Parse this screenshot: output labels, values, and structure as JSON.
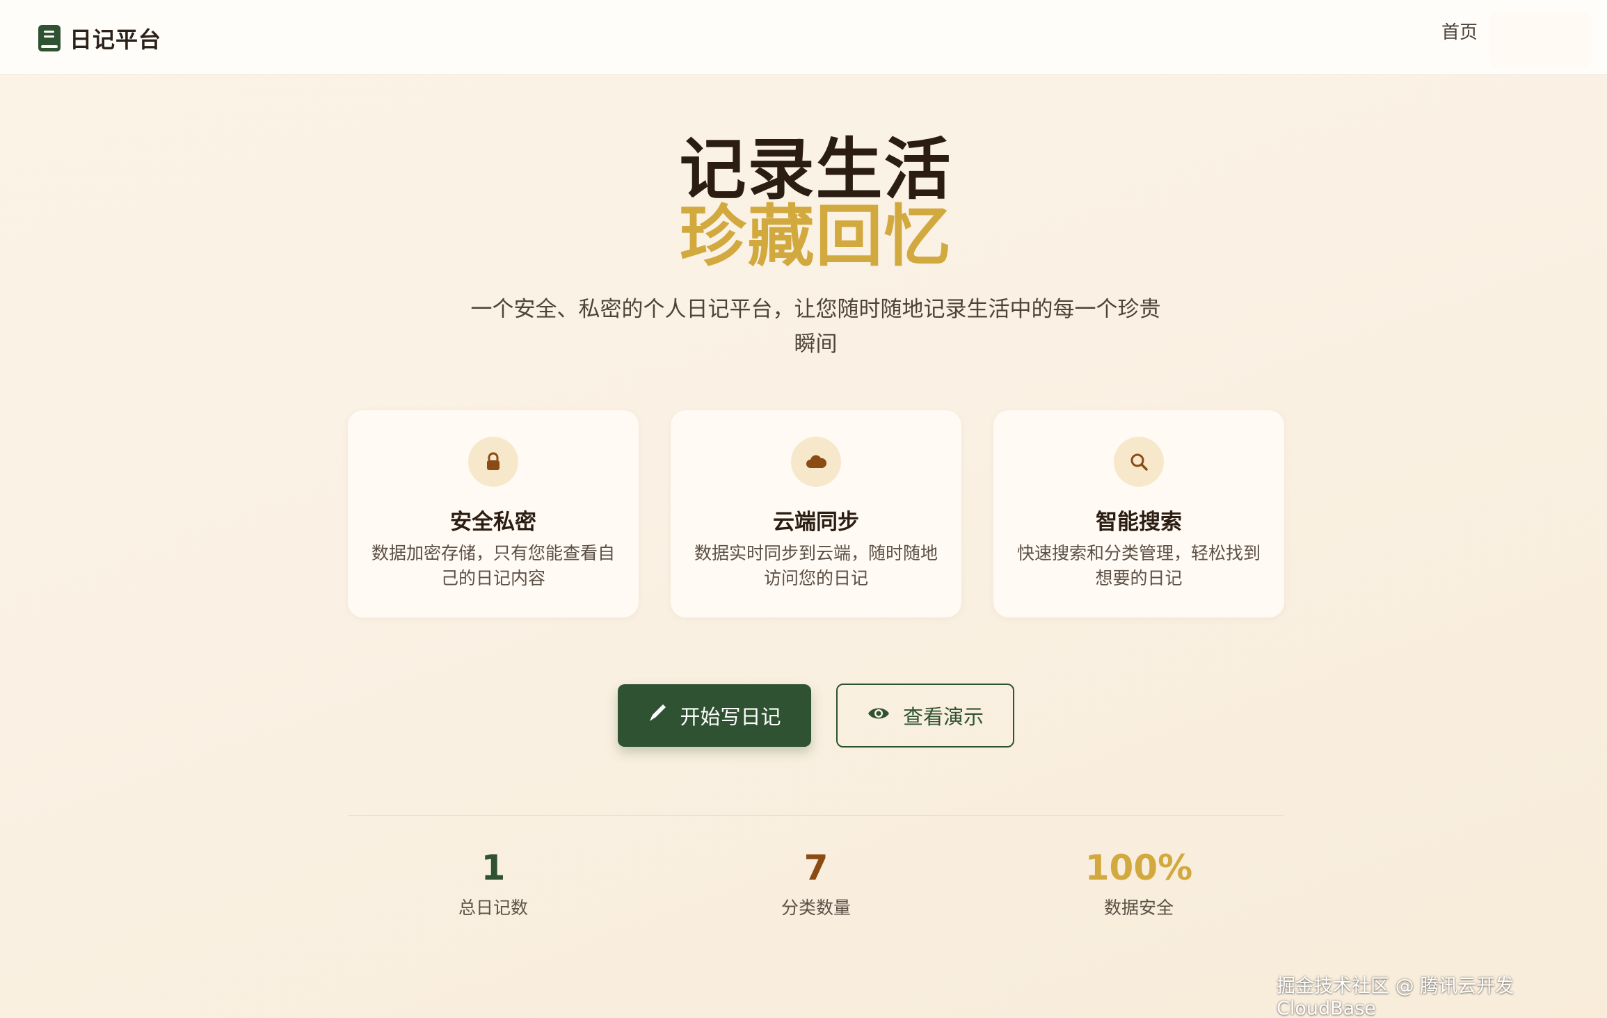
{
  "header": {
    "logo_text": "日记平台",
    "nav": {
      "home": "首页"
    }
  },
  "hero": {
    "title_line1": "记录生活",
    "title_line2": "珍藏回忆",
    "subtitle": "一个安全、私密的个人日记平台，让您随时随地记录生活中的每一个珍贵瞬间"
  },
  "features": [
    {
      "icon": "lock-icon",
      "title": "安全私密",
      "desc": "数据加密存储，只有您能查看自己的日记内容"
    },
    {
      "icon": "cloud-icon",
      "title": "云端同步",
      "desc": "数据实时同步到云端，随时随地访问您的日记"
    },
    {
      "icon": "search-icon",
      "title": "智能搜索",
      "desc": "快速搜索和分类管理，轻松找到想要的日记"
    }
  ],
  "actions": {
    "primary_label": "开始写日记",
    "primary_icon": "pen-icon",
    "secondary_label": "查看演示",
    "secondary_icon": "eye-icon"
  },
  "stats": [
    {
      "value": "1",
      "label": "总日记数"
    },
    {
      "value": "7",
      "label": "分类数量"
    },
    {
      "value": "100%",
      "label": "数据安全"
    }
  ],
  "watermark": "掘金技术社区 @ 腾讯云开发CloudBase",
  "colors": {
    "brand_green": "#2f5233",
    "gold": "#d2a93f",
    "brown": "#8a4b14",
    "icon_bg": "#f7e8cc"
  }
}
